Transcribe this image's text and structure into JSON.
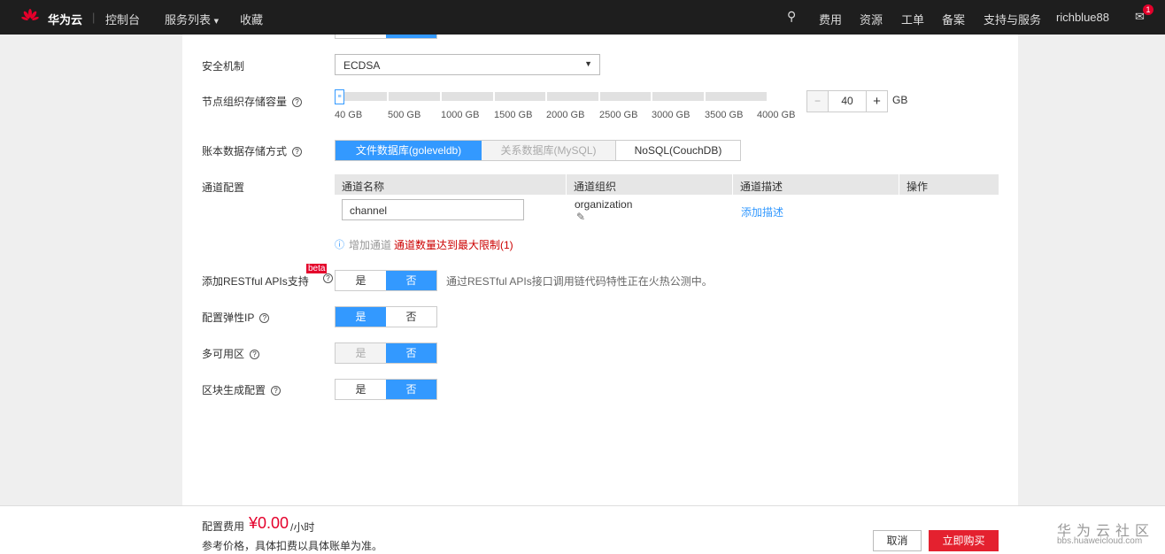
{
  "topbar": {
    "brand": "华为云",
    "console": "控制台",
    "services": "服务列表",
    "favorites": "收藏",
    "fees": "费用",
    "resources": "资源",
    "tickets": "工单",
    "filing": "备案",
    "support": "支持与服务",
    "user": "richblue88",
    "badge": "1"
  },
  "form": {
    "security_label": "安全机制",
    "security_value": "ECDSA",
    "storage_label": "节点组织存储容量",
    "storage_ticks": [
      "40 GB",
      "500 GB",
      "1000 GB",
      "1500 GB",
      "2000 GB",
      "2500 GB",
      "3000 GB",
      "3500 GB",
      "4000 GB"
    ],
    "storage_value": "40",
    "storage_unit": "GB",
    "storage_fraction": 0,
    "ledger_label": "账本数据存储方式",
    "ledger_options": [
      "文件数据库(goleveldb)",
      "关系数据库(MySQL)",
      "NoSQL(CouchDB)"
    ],
    "channel_label": "通道配置",
    "channel_headers": [
      "通道名称",
      "通道组织",
      "通道描述",
      "操作"
    ],
    "channel_name": "channel",
    "channel_org": "organization",
    "channel_desc_link": "添加描述",
    "add_channel": "增加通道",
    "channel_limit": "通道数量达到最大限制(1)",
    "restful_label": "添加RESTful APIs支持",
    "beta": "beta",
    "restful_note": "通过RESTful APIs接口调用链代码特性正在火热公测中。",
    "eip_label": "配置弹性IP",
    "az_label": "多可用区",
    "block_label": "区块生成配置",
    "yes": "是",
    "no": "否"
  },
  "footer": {
    "fee_label": "配置费用",
    "price": "¥0.00",
    "per": "/小时",
    "note": "参考价格，具体扣费以具体账单为准。",
    "cancel": "取消",
    "buy": "立即购买",
    "watermark_cn": "华为云社区",
    "watermark_url": "bbs.huaweicloud.com"
  }
}
